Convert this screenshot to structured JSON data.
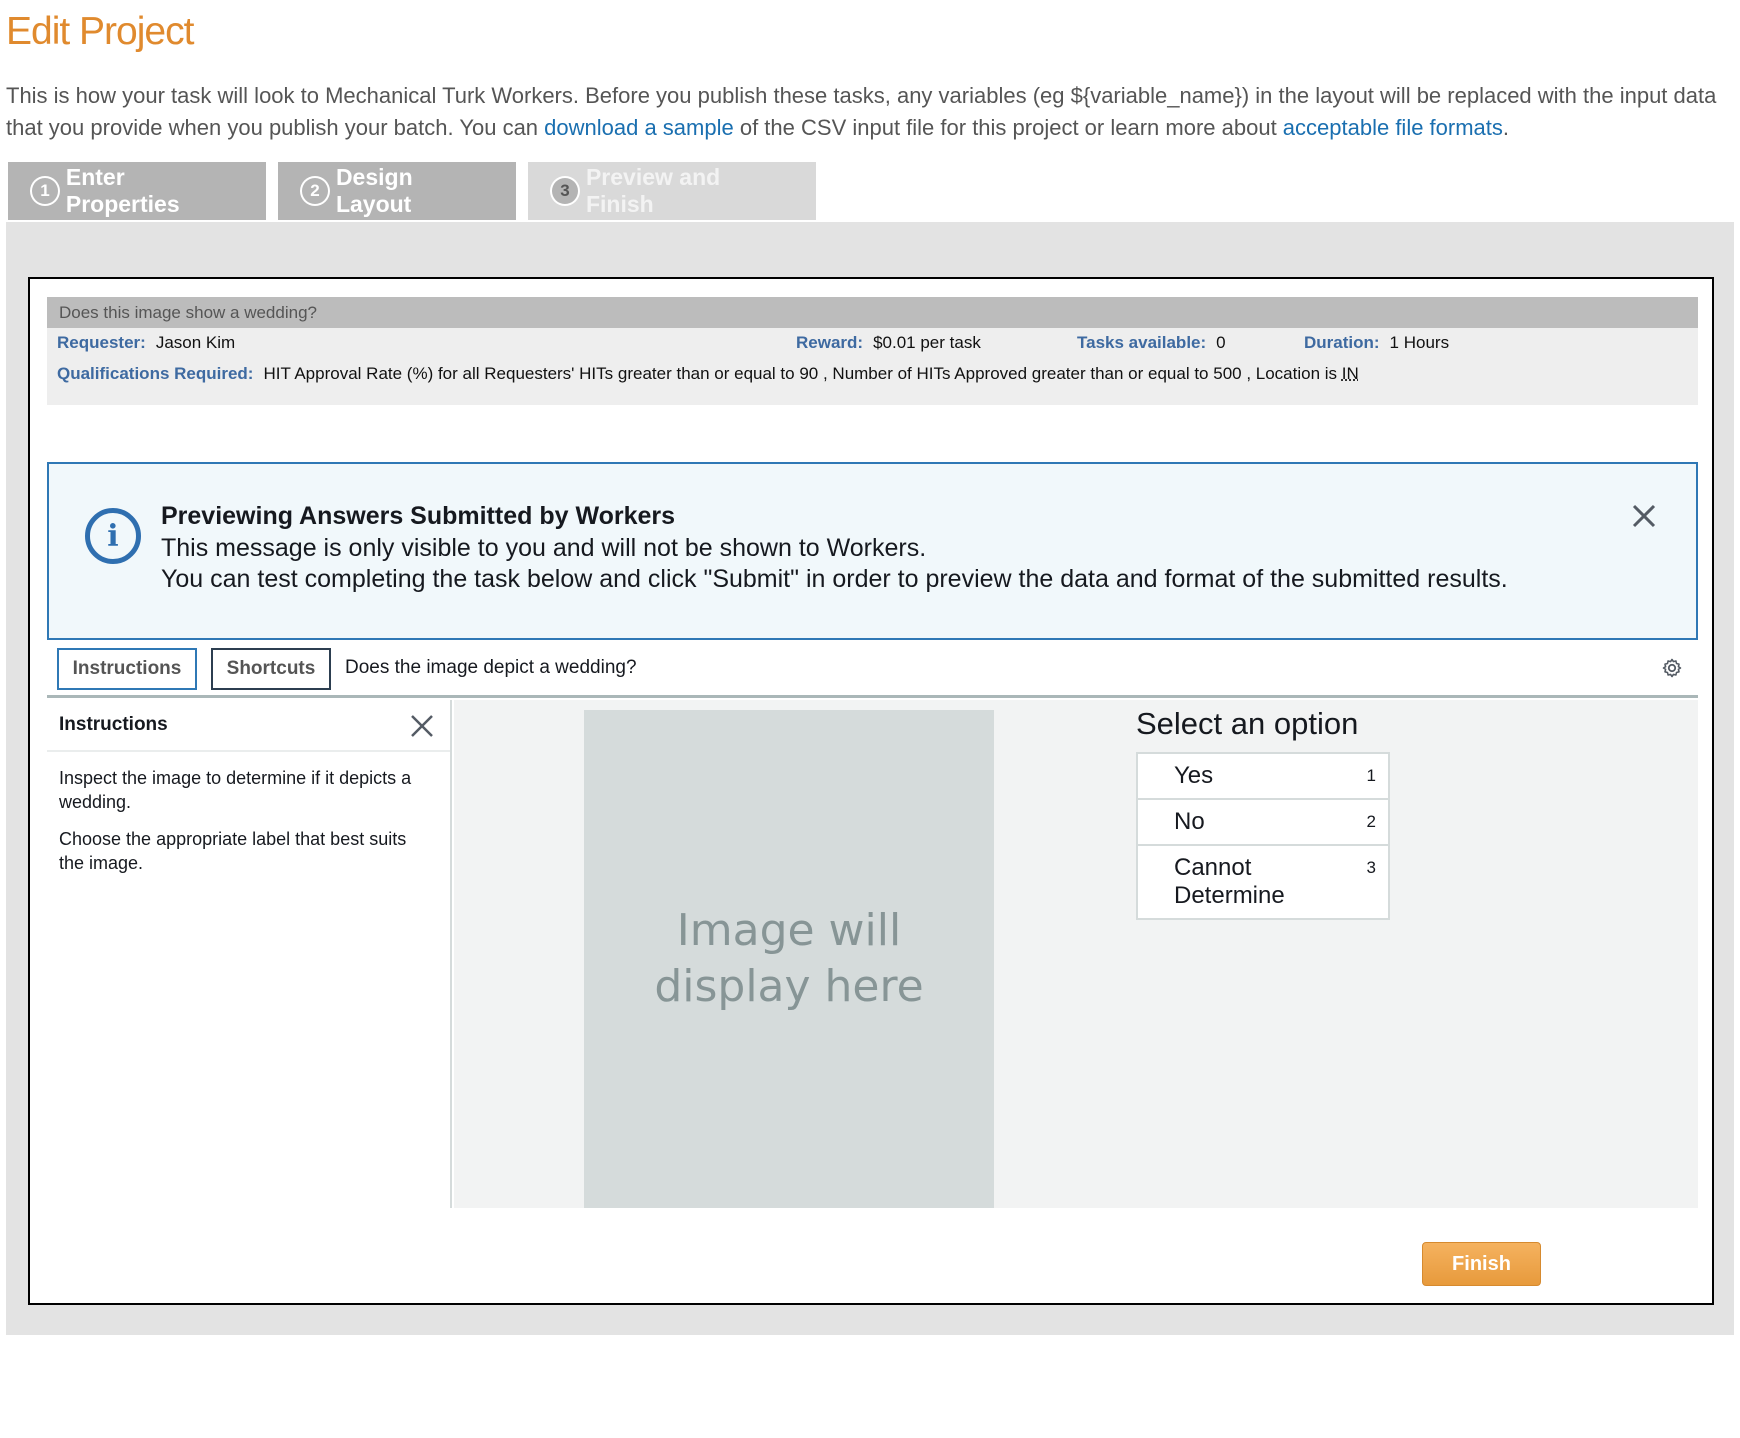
{
  "page": {
    "title": "Edit Project",
    "intro_text_1": "This is how your task will look to Mechanical Turk Workers. Before you publish these tasks, any variables (eg ${variable_name}) in the layout will be replaced with the input data that you provide when you publish your batch. You can ",
    "intro_link_1": "download a sample",
    "intro_text_2": " of the CSV input file for this project or learn more about ",
    "intro_link_2": "acceptable file formats",
    "intro_text_3": "."
  },
  "steps": [
    {
      "num": "1",
      "label": "Enter Properties"
    },
    {
      "num": "2",
      "label": "Design Layout"
    },
    {
      "num": "3",
      "label": "Preview and Finish"
    }
  ],
  "hit": {
    "title": "Does this image show a wedding?",
    "requester_label": "Requester:",
    "requester": "Jason Kim",
    "reward_label": "Reward:",
    "reward": "$0.01 per task",
    "tasks_label": "Tasks available:",
    "tasks": "0",
    "duration_label": "Duration:",
    "duration": "1 Hours",
    "qual_label": "Qualifications Required:",
    "qual_text": "HIT Approval Rate (%) for all Requesters' HITs greater than or equal to 90 , Number of HITs Approved greater than or equal to 500 , Location is ",
    "qual_loc": "IN"
  },
  "alert": {
    "title": "Previewing Answers Submitted by Workers",
    "line1": "This message is only visible to you and will not be shown to Workers.",
    "line2": "You can test completing the task below and click \"Submit\" in order to preview the data and format of the submitted results."
  },
  "toolbar": {
    "instructions_btn": "Instructions",
    "shortcuts_btn": "Shortcuts",
    "question": "Does the image depict a wedding?"
  },
  "instructions": {
    "title": "Instructions",
    "p1": "Inspect the image to determine if it depicts a wedding.",
    "p2": "Choose the appropriate label that best suits the image."
  },
  "image_placeholder": {
    "line1": "Image will",
    "line2": "display here"
  },
  "options": {
    "title": "Select an option",
    "items": [
      {
        "label": "Yes",
        "key": "1"
      },
      {
        "label": "No",
        "key": "2"
      },
      {
        "label": "Cannot Determine",
        "key": "3"
      }
    ]
  },
  "finish_label": "Finish",
  "colors": {
    "title_orange": "#e08a2e",
    "link_blue": "#1a6fb0",
    "label_blue": "#3e6aa1",
    "alert_border": "#2f78b5"
  }
}
